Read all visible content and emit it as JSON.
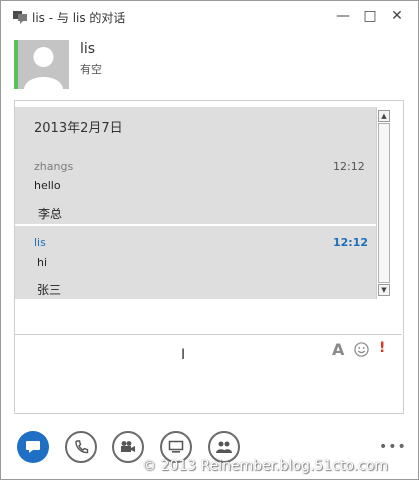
{
  "window": {
    "title": "lis - 与 lis 的对话"
  },
  "titlebar_buttons": {
    "minimize": "—",
    "maximize": "□",
    "close": "✕"
  },
  "contact": {
    "name": "lis",
    "status": "有空",
    "presence_color": "#56c156"
  },
  "conversation": {
    "date": "2013年2月7日",
    "messages": [
      {
        "sender": "zhangs",
        "time": "12:12",
        "lines": [
          "hello",
          "李总"
        ],
        "sender_color": "#7a7a7a"
      },
      {
        "sender": "lis",
        "time": "12:12",
        "lines": [
          "hi",
          "张三"
        ],
        "sender_color": "#1e6fb8"
      }
    ]
  },
  "compose": {
    "format_label": "A",
    "urgent_label": "!"
  },
  "toolbar": {
    "icons": [
      "chat-icon",
      "phone-icon",
      "video-icon",
      "present-icon",
      "participants-icon"
    ],
    "more_label": "•••"
  },
  "watermark": "© 2013 Reinember.blog.51cto.com"
}
